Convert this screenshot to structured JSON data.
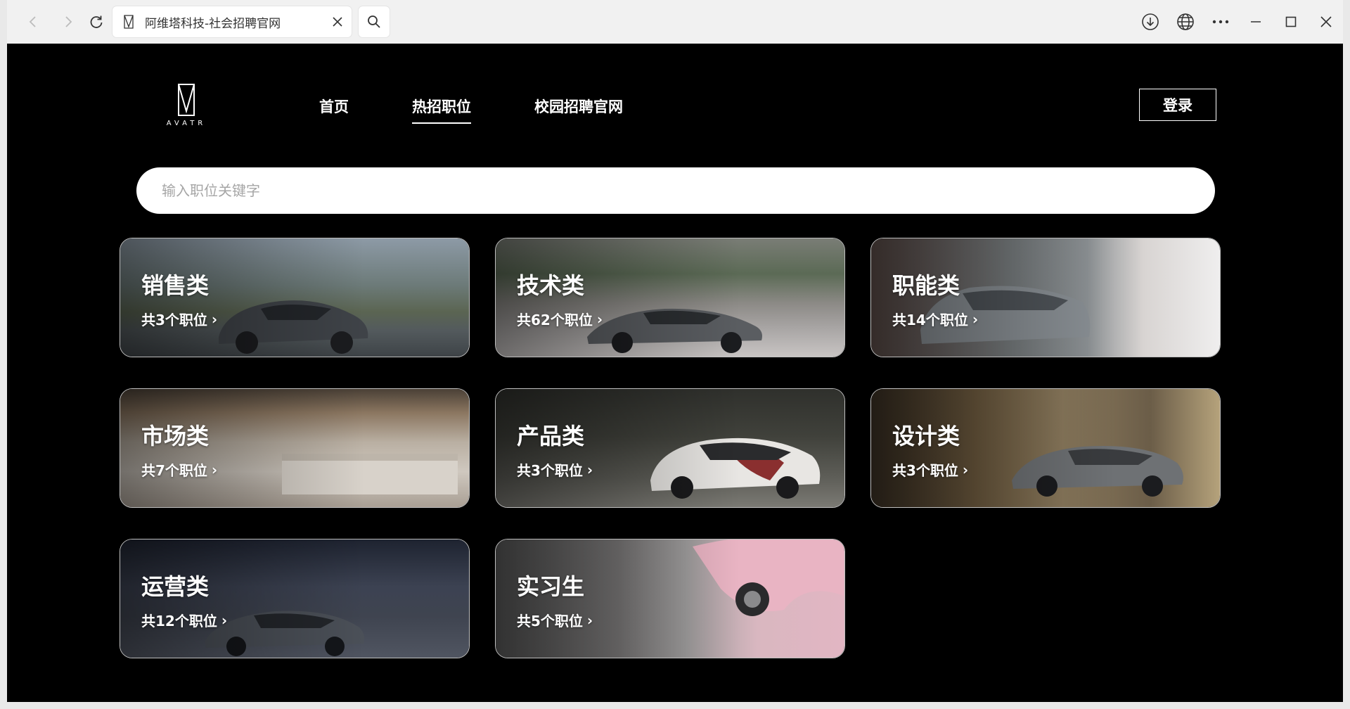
{
  "browser": {
    "tab_title": "阿维塔科技-社会招聘官网"
  },
  "site": {
    "logo_text": "AVATR",
    "nav": [
      "首页",
      "热招职位",
      "校园招聘官网"
    ],
    "login_label": "登录",
    "search_placeholder": "输入职位关键字"
  },
  "categories": [
    {
      "title": "销售类",
      "count": "共3个职位"
    },
    {
      "title": "技术类",
      "count": "共62个职位"
    },
    {
      "title": "职能类",
      "count": "共14个职位"
    },
    {
      "title": "市场类",
      "count": "共7个职位"
    },
    {
      "title": "产品类",
      "count": "共3个职位"
    },
    {
      "title": "设计类",
      "count": "共3个职位"
    },
    {
      "title": "运营类",
      "count": "共12个职位"
    },
    {
      "title": "实习生",
      "count": "共5个职位"
    }
  ],
  "icons": {
    "back": "arrow-left-icon",
    "forward": "arrow-right-icon",
    "reload": "reload-icon",
    "search": "search-icon",
    "download": "download-icon",
    "globe": "globe-icon",
    "more": "more-icon",
    "minimize": "minimize-icon",
    "maximize": "maximize-icon",
    "close": "close-icon"
  }
}
